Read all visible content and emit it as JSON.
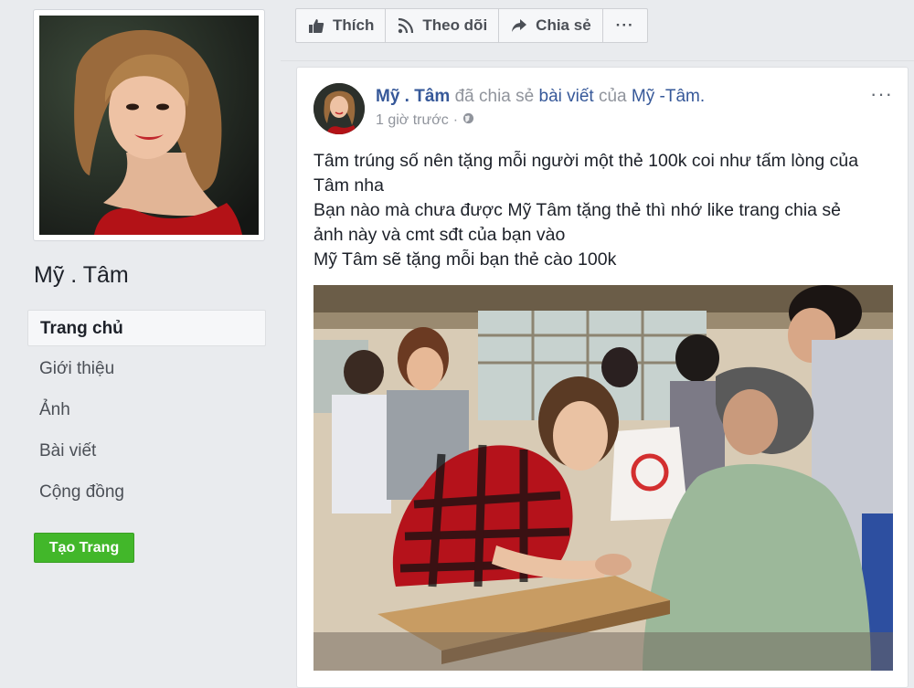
{
  "page": {
    "name": "Mỹ . Tâm",
    "nav": [
      "Trang chủ",
      "Giới thiệu",
      "Ảnh",
      "Bài viết",
      "Cộng đồng"
    ],
    "create_page_label": "Tạo Trang"
  },
  "actions": {
    "like_label": "Thích",
    "follow_label": "Theo dõi",
    "share_label": "Chia sẻ",
    "more_label": "···"
  },
  "post": {
    "author": "Mỹ . Tâm",
    "shared_text": "đã chia sẻ",
    "post_link": "bài viết",
    "of_text": "của",
    "original_author": "Mỹ -Tâm.",
    "timestamp": "1 giờ trước",
    "privacy_icon": "globe-icon",
    "more_label": "···",
    "lines": [
      "Tâm trúng số nên tặng mỗi người một thẻ 100k coi như tấm lòng của",
      "Tâm nha",
      "Bạn nào mà chưa được Mỹ Tâm tặng thẻ thì nhớ like trang chia sẻ",
      "ảnh này và cmt sđt của bạn vào",
      "Mỹ Tâm sẽ tặng mỗi bạn thẻ cào 100k"
    ]
  },
  "colors": {
    "link": "#365899",
    "green_button": "#42b72a",
    "background": "#e9ebee"
  }
}
